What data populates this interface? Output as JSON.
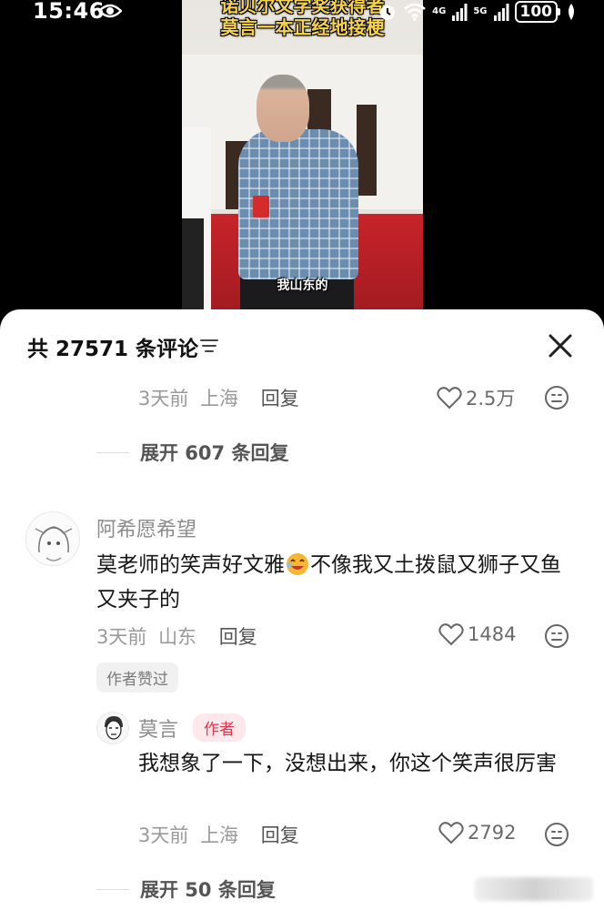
{
  "status_bar": {
    "time": "15:46",
    "net1": "4G",
    "net2": "5G",
    "battery": "100"
  },
  "video": {
    "title_line1": "诺贝尔文学奖获得者",
    "title_line2": "莫言一本正经地接梗",
    "subtitle": "我山东的"
  },
  "sheet": {
    "title": "共 27571 条评论"
  },
  "comments": [
    {
      "time": "3天前",
      "location": "上海",
      "reply_label": "回复",
      "likes": "2.5万",
      "expand_label": "展开 607 条回复"
    },
    {
      "username": "阿希愿希望",
      "text_before_emoji": "莫老师的笑声好文雅",
      "text_after_emoji": "不像我又土拨鼠又狮子又鱼又夹子的",
      "time": "3天前",
      "location": "山东",
      "reply_label": "回复",
      "likes": "1484",
      "author_liked": "作者赞过"
    },
    {
      "username": "莫言",
      "author_tag": "作者",
      "text": "我想象了一下，没想出来，你这个笑声很厉害",
      "time": "3天前",
      "location": "上海",
      "reply_label": "回复",
      "likes": "2792",
      "expand_label": "展开 50 条回复"
    }
  ],
  "colors": {
    "author_tag": "#e8344e",
    "subtitle_yellow": "#f6d34a"
  }
}
